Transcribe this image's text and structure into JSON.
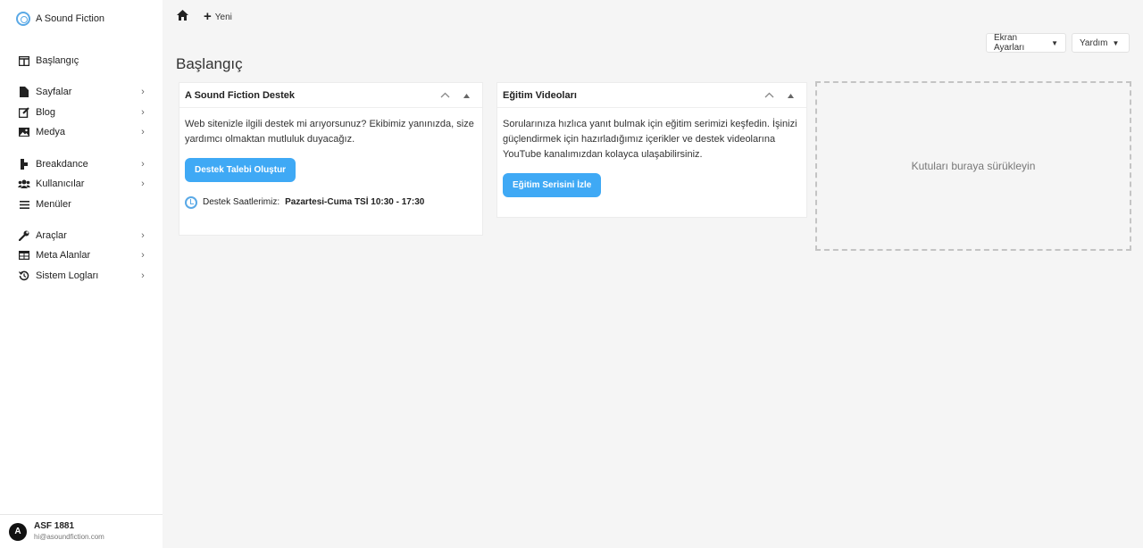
{
  "brand": {
    "name": "A Sound Fiction",
    "color": "#5aa9e6"
  },
  "nav": [
    {
      "label": "Başlangıç",
      "icon": "dashboard-icon",
      "chevron": false
    },
    {
      "label": "Sayfalar",
      "icon": "pages-icon",
      "chevron": true
    },
    {
      "label": "Blog",
      "icon": "edit-icon",
      "chevron": true
    },
    {
      "label": "Medya",
      "icon": "media-icon",
      "chevron": true
    },
    {
      "label": "Breakdance",
      "icon": "breakdance-icon",
      "chevron": true
    },
    {
      "label": "Kullanıcılar",
      "icon": "users-icon",
      "chevron": true
    },
    {
      "label": "Menüler",
      "icon": "menu-icon",
      "chevron": false
    },
    {
      "label": "Araçlar",
      "icon": "wrench-icon",
      "chevron": true
    },
    {
      "label": "Meta Alanlar",
      "icon": "table-icon",
      "chevron": true
    },
    {
      "label": "Sistem Logları",
      "icon": "history-icon",
      "chevron": true
    }
  ],
  "user": {
    "initial": "A",
    "name": "ASF 1881",
    "email": "hi@asoundfiction.com"
  },
  "topbar": {
    "new_label": "Yeni"
  },
  "screen_options": {
    "label": "Ekran Ayarları"
  },
  "help": {
    "label": "Yardım"
  },
  "page": {
    "title": "Başlangıç"
  },
  "support_card": {
    "title": "A Sound Fiction Destek",
    "text": "Web sitenizle ilgili destek mi arıyorsunuz? Ekibimiz yanınızda, size yardımcı olmaktan mutluluk duyacağız.",
    "button": "Destek Talebi Oluştur",
    "hours_label": "Destek Saatlerimiz:",
    "hours_value": "Pazartesi-Cuma TSİ 10:30 - 17:30"
  },
  "video_card": {
    "title": "Eğitim Videoları",
    "text": "Sorularınıza hızlıca yanıt bulmak için eğitim serimizi keşfedin. İşinizi güçlendirmek için hazırladığımız içerikler ve destek videolarına YouTube kanalımızdan kolayca ulaşabilirsiniz.",
    "button": "Eğitim Serisini İzle"
  },
  "drop_zone": {
    "text": "Kutuları buraya sürükleyin"
  },
  "accent": "#3fa9f5"
}
